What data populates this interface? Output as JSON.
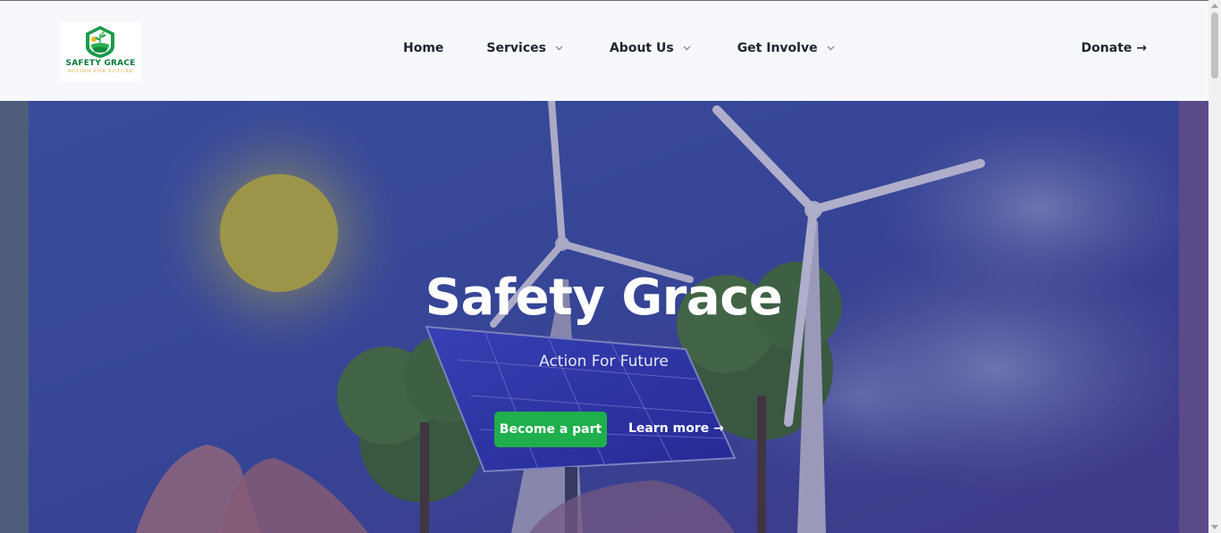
{
  "brand": {
    "name": "SAFETY GRACE",
    "tagline": "ACTION FOR FUTURE",
    "logo_icon": "leaf-shield-icon"
  },
  "nav": {
    "home": "Home",
    "services": "Services",
    "about": "About Us",
    "get_involved": "Get Involve",
    "donate": "Donate →"
  },
  "hero": {
    "title": "Safety Grace",
    "subtitle": "Action For Future",
    "primary_button": "Become a part",
    "secondary_link": "Learn more →"
  },
  "colors": {
    "accent_green": "#1faf4c",
    "header_bg": "#f7f8fb",
    "nav_text": "#1e2430",
    "hero_overlay": "#2c2a7a"
  }
}
